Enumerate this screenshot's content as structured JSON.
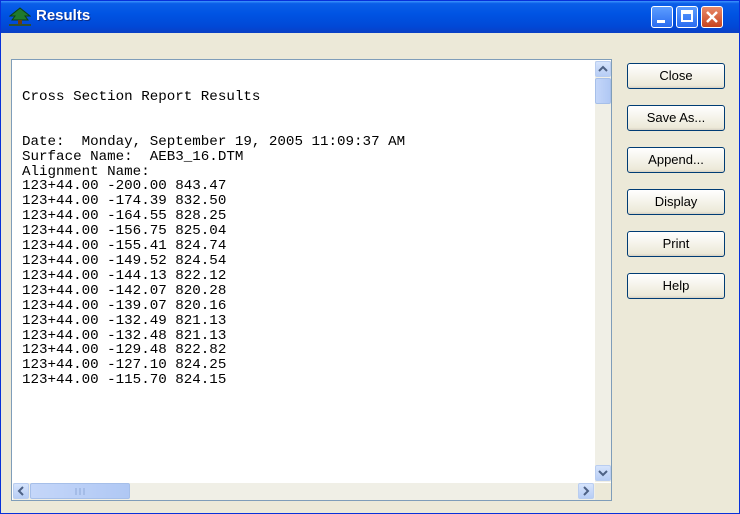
{
  "window": {
    "title": "Results"
  },
  "report": {
    "heading": "Cross Section Report Results",
    "date_line": "Date:  Monday, September 19, 2005 11:09:37 AM",
    "surface_line": "Surface Name:  AEB3_16.DTM",
    "alignment_line": "Alignment Name:",
    "rows": [
      "123+44.00 -200.00 843.47",
      "123+44.00 -174.39 832.50",
      "123+44.00 -164.55 828.25",
      "123+44.00 -156.75 825.04",
      "123+44.00 -155.41 824.74",
      "123+44.00 -149.52 824.54",
      "123+44.00 -144.13 822.12",
      "123+44.00 -142.07 820.28",
      "123+44.00 -139.07 820.16",
      "123+44.00 -132.49 821.13",
      "123+44.00 -132.48 821.13",
      "123+44.00 -129.48 822.82",
      "123+44.00 -127.10 824.25",
      "123+44.00 -115.70 824.15"
    ]
  },
  "buttons": {
    "close": "Close",
    "save_as": "Save As...",
    "append": "Append...",
    "display": "Display",
    "print": "Print",
    "help": "Help"
  },
  "icons": {
    "app": "tree-icon",
    "minimize": "minimize-icon",
    "maximize": "maximize-icon",
    "close": "close-icon"
  },
  "colors": {
    "titlebar": "#0054e3",
    "window_bg": "#ece9d8",
    "close_button": "#c8431e"
  }
}
